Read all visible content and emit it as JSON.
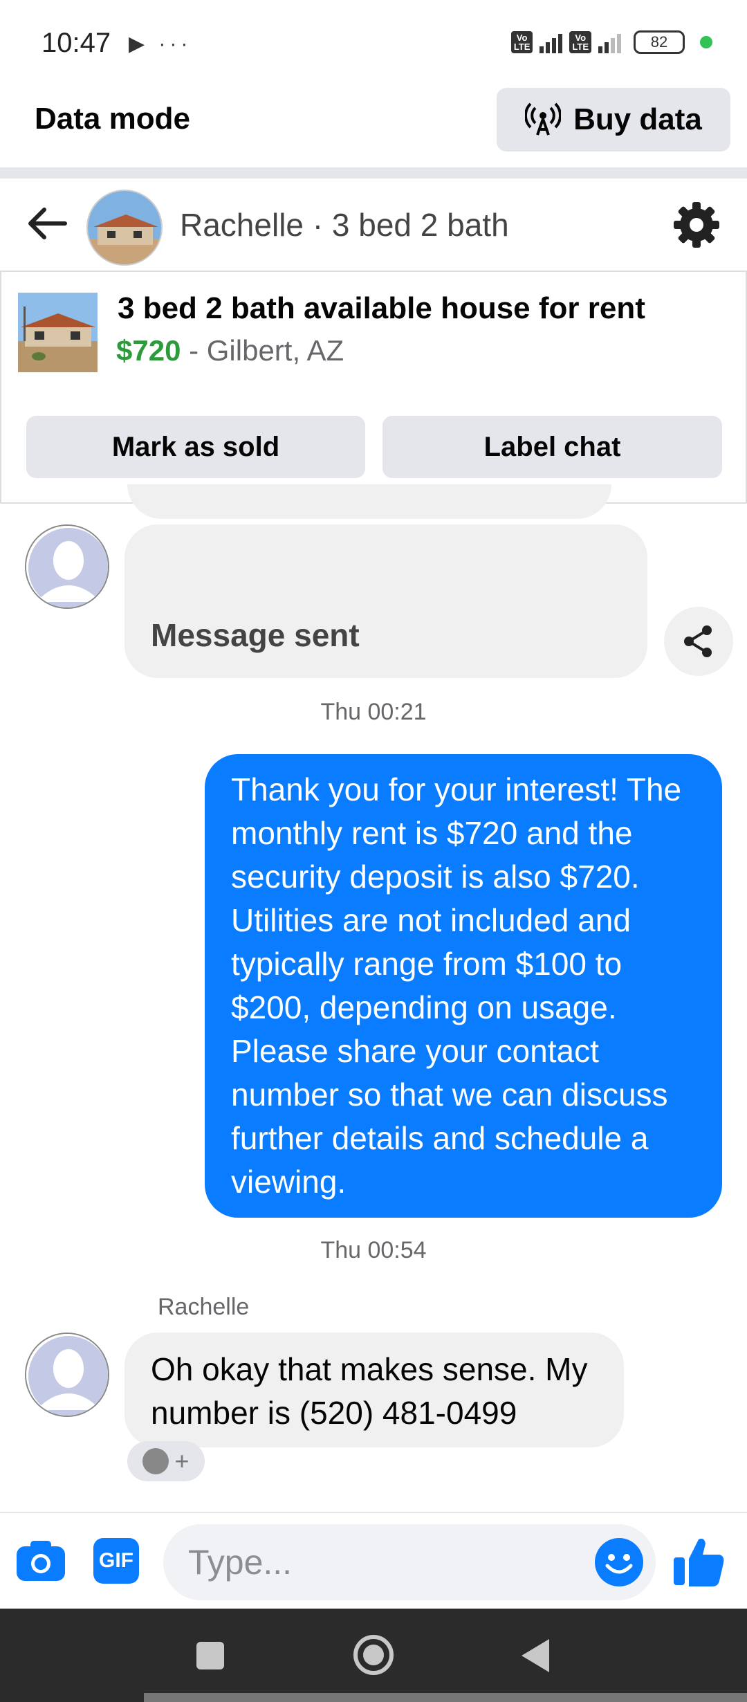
{
  "status_bar": {
    "time": "10:47",
    "left_icons": "▶ ···",
    "lte_label": "Vo LTE",
    "network": "4G",
    "battery": "82"
  },
  "data_mode": {
    "title": "Data mode",
    "buy_label": "Buy data"
  },
  "chat_header": {
    "title": "Rachelle · 3 bed 2 bath"
  },
  "listing": {
    "title": "3 bed 2 bath available house for rent",
    "price": "$720",
    "location": " - Gilbert, AZ",
    "mark_sold_label": "Mark as sold",
    "label_chat_label": "Label chat"
  },
  "messages": {
    "sent_notice": "Message sent",
    "timestamp_1": "Thu 00:21",
    "outgoing": "Thank you for your interest! The monthly rent is $720 and the security deposit is also $720. Utilities are not included and typically range from $100 to $200, depending on usage. Please share your contact number so that we can discuss further details and schedule a viewing.",
    "timestamp_2": "Thu 00:54",
    "sender": "Rachelle",
    "reply": "Oh okay that makes sense. My number is (520) 481-0499",
    "react_plus": "+"
  },
  "composer": {
    "gif_label": "GIF",
    "placeholder": "Type..."
  },
  "colors": {
    "messenger_blue": "#0a7cff",
    "price_green": "#2d9a3c",
    "bubble_gray": "#f0f0f0"
  }
}
